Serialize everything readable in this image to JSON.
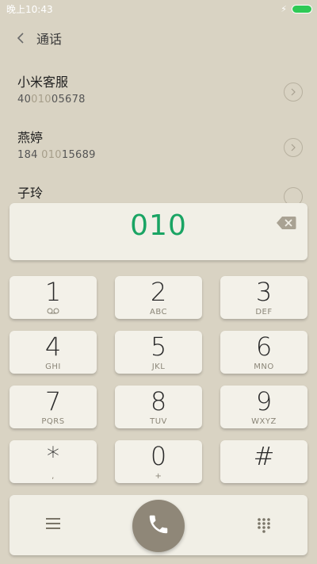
{
  "status_bar": {
    "time": "晚上10:43",
    "battery_color": "#2ec955"
  },
  "header": {
    "title": "通话"
  },
  "contacts": [
    {
      "name": "小米客服",
      "number_pre": "40",
      "number_hl": "010",
      "number_post": "05678"
    },
    {
      "name": "燕婷",
      "number_pre": "184 ",
      "number_hl": "010",
      "number_post": "15689"
    },
    {
      "name": "子玲"
    }
  ],
  "dialer": {
    "display_value": "010",
    "keys": [
      {
        "digit": "1",
        "sub": ""
      },
      {
        "digit": "2",
        "sub": "ABC"
      },
      {
        "digit": "3",
        "sub": "DEF"
      },
      {
        "digit": "4",
        "sub": "GHI"
      },
      {
        "digit": "5",
        "sub": "JKL"
      },
      {
        "digit": "6",
        "sub": "MNO"
      },
      {
        "digit": "7",
        "sub": "PQRS"
      },
      {
        "digit": "8",
        "sub": "TUV"
      },
      {
        "digit": "9",
        "sub": "WXYZ"
      },
      {
        "digit": "*",
        "sub": ","
      },
      {
        "digit": "0",
        "sub": "+"
      },
      {
        "digit": "#",
        "sub": ""
      }
    ]
  },
  "colors": {
    "accent": "#19a463",
    "call_button": "#8f8778",
    "background": "#d9d3c3"
  },
  "icons": [
    "back-icon",
    "chevron-right-icon",
    "backspace-icon",
    "voicemail-icon",
    "menu-icon",
    "phone-icon",
    "dialpad-icon"
  ]
}
